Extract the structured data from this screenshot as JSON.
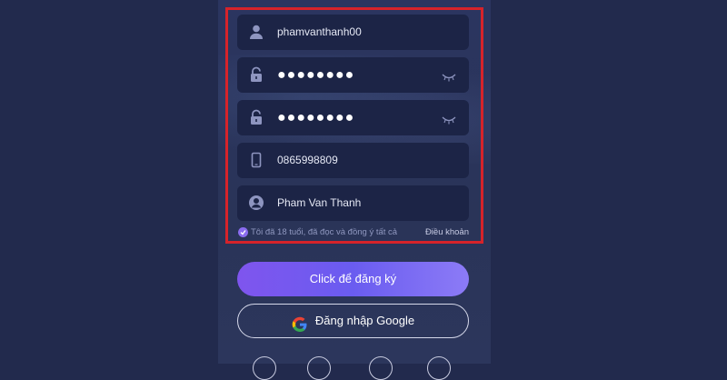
{
  "form": {
    "username": "phamvanthanh00",
    "password": "●●●●●●●●",
    "confirm_password": "●●●●●●●●",
    "phone": "0865998809",
    "full_name": "Pham Van Thanh"
  },
  "agreement": {
    "text": "Tôi đã 18 tuổi, đã đọc và đồng ý tất cả",
    "terms_link": "Điều khoản",
    "checked": true
  },
  "buttons": {
    "register": "Click để đăng ký",
    "google_login": "Đăng nhập Google"
  },
  "icons": {
    "username": "user-icon",
    "password": "lock-icon",
    "phone": "phone-icon",
    "full_name": "person-circle-icon",
    "toggle_visibility": "eye-closed-icon",
    "google": "google-icon"
  },
  "colors": {
    "background": "#222a4d",
    "field": "#1c2446",
    "highlight": "#d6232a",
    "accent": "#7f55ee"
  }
}
